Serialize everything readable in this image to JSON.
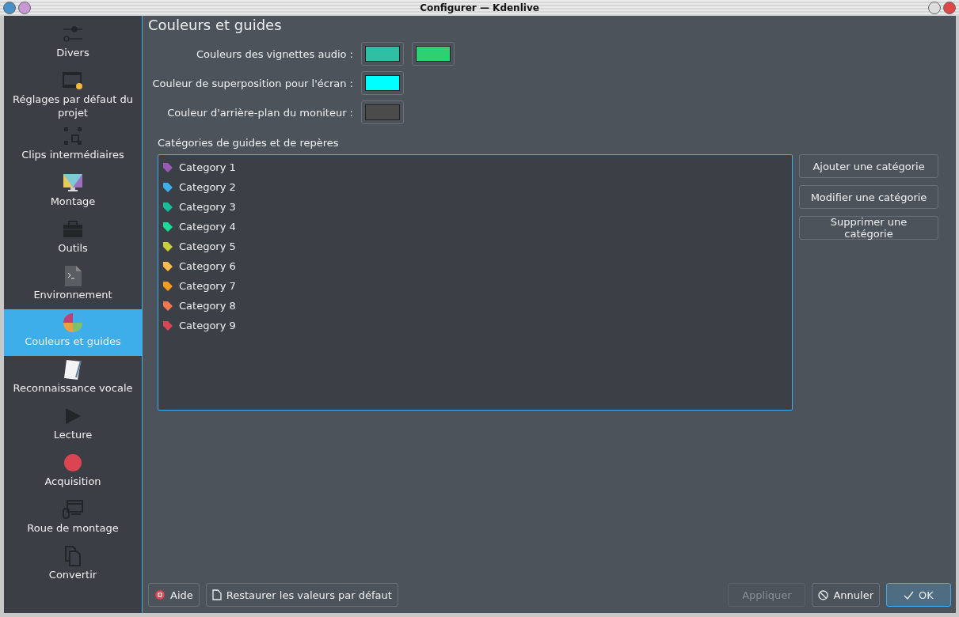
{
  "window": {
    "title": "Configurer — Kdenlive"
  },
  "sidebar": {
    "items": [
      {
        "label": "Divers",
        "selected": false
      },
      {
        "label": "Réglages par défaut du projet",
        "selected": false
      },
      {
        "label": "Clips intermédiaires",
        "selected": false
      },
      {
        "label": "Montage",
        "selected": false
      },
      {
        "label": "Outils",
        "selected": false
      },
      {
        "label": "Environnement",
        "selected": false
      },
      {
        "label": "Couleurs et guides",
        "selected": true
      },
      {
        "label": "Reconnaissance vocale",
        "selected": false
      },
      {
        "label": "Lecture",
        "selected": false
      },
      {
        "label": "Acquisition",
        "selected": false
      },
      {
        "label": "Roue de montage",
        "selected": false
      },
      {
        "label": "Convertir",
        "selected": false
      }
    ]
  },
  "page": {
    "title": "Couleurs et guides",
    "color_settings": [
      {
        "label": "Couleurs des vignettes audio :",
        "swatches": [
          {
            "color": "#2ebfa5"
          },
          {
            "color": "#2dd173"
          }
        ]
      },
      {
        "label": "Couleur de superposition pour l'écran :",
        "swatches": [
          {
            "color": "#00ffff"
          }
        ]
      },
      {
        "label": "Couleur d'arrière-plan du moniteur :",
        "swatches": [
          {
            "color": "#4b4b4b"
          }
        ]
      }
    ],
    "categories_label": "Catégories de guides et de repères",
    "categories": [
      {
        "label": "Category 1",
        "color": "#9b59b6"
      },
      {
        "label": "Category 2",
        "color": "#3daee9"
      },
      {
        "label": "Category 3",
        "color": "#1abc9c"
      },
      {
        "label": "Category 4",
        "color": "#1cdc9a"
      },
      {
        "label": "Category 5",
        "color": "#c9ce3b"
      },
      {
        "label": "Category 6",
        "color": "#fdbc4b"
      },
      {
        "label": "Category 7",
        "color": "#f39c1f"
      },
      {
        "label": "Category 8",
        "color": "#f47750"
      },
      {
        "label": "Category 9",
        "color": "#da4453"
      }
    ],
    "category_buttons": [
      "Ajouter une catégorie",
      "Modifier une catégorie",
      "Supprimer une catégorie"
    ]
  },
  "buttons": [
    {
      "label": "Aide",
      "kind": "help",
      "disabled": false,
      "default": false
    },
    {
      "label": "Restaurer les valeurs par défaut",
      "kind": "restore",
      "disabled": false,
      "default": false
    },
    {
      "label": "Appliquer",
      "kind": "apply",
      "disabled": true,
      "default": false
    },
    {
      "label": "Annuler",
      "kind": "cancel",
      "disabled": false,
      "default": false
    },
    {
      "label": "OK",
      "kind": "ok",
      "disabled": false,
      "default": true
    }
  ]
}
